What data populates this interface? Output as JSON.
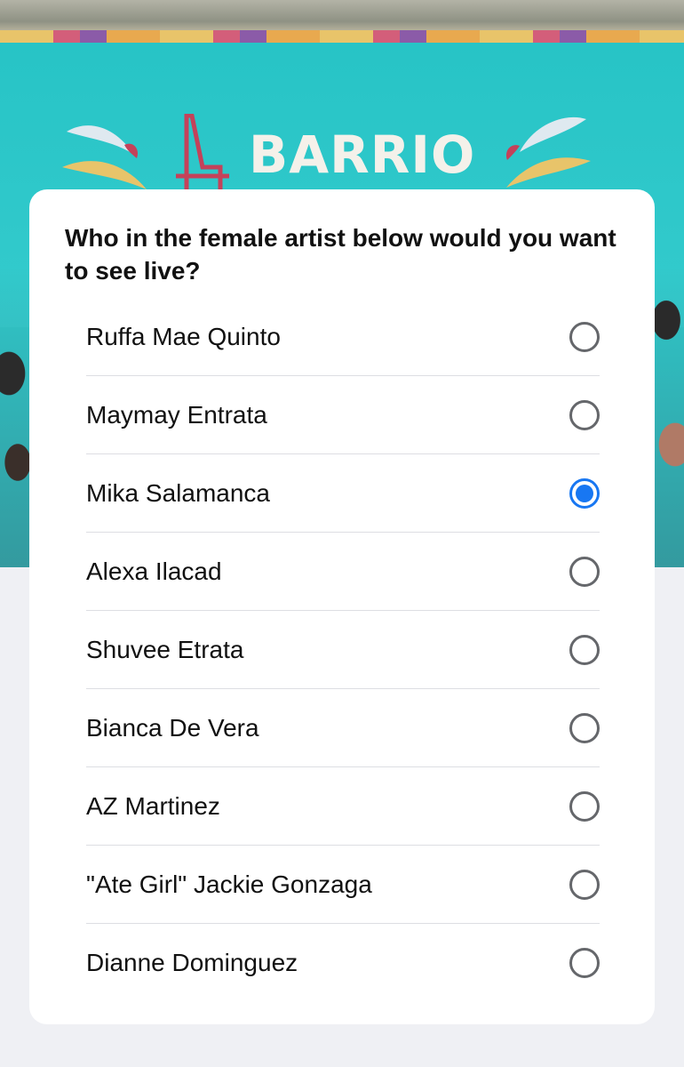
{
  "hero": {
    "logo_text": "BARRIO"
  },
  "poll": {
    "question": "Who in the female artist below would you want to see live?",
    "selected_index": 2,
    "options": [
      {
        "label": "Ruffa Mae Quinto",
        "selected": false
      },
      {
        "label": "Maymay Entrata",
        "selected": false
      },
      {
        "label": "Mika Salamanca",
        "selected": true
      },
      {
        "label": "Alexa Ilacad",
        "selected": false
      },
      {
        "label": "Shuvee Etrata",
        "selected": false
      },
      {
        "label": "Bianca De Vera",
        "selected": false
      },
      {
        "label": "AZ Martinez",
        "selected": false
      },
      {
        "label": "\"Ate Girl\" Jackie Gonzaga",
        "selected": false
      },
      {
        "label": "Dianne Dominguez",
        "selected": false
      }
    ]
  },
  "colors": {
    "accent": "#1877f2",
    "radio_border": "#65676b",
    "backdrop": "#2fc7c9",
    "page_background": "#eff0f4"
  },
  "icons": {
    "radio_unselected": "radio-empty-icon",
    "radio_selected": "radio-checked-icon"
  }
}
